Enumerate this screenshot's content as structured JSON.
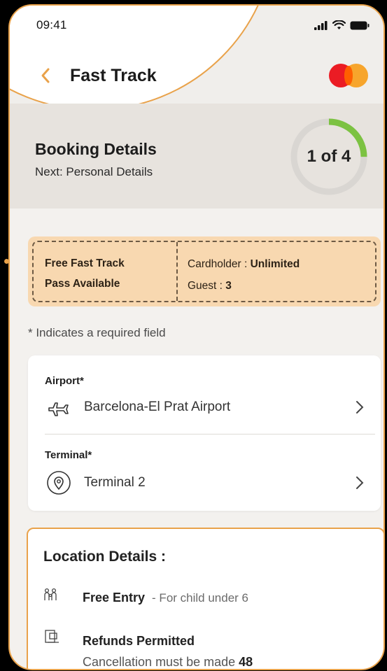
{
  "status_bar": {
    "time": "09:41"
  },
  "header": {
    "title": "Fast Track"
  },
  "booking": {
    "title": "Booking Details",
    "next": "Next: Personal Details",
    "step_label": "1 of 4",
    "step_current": 1,
    "step_total": 4
  },
  "pass": {
    "line1": "Free Fast Track",
    "line2": "Pass Available",
    "cardholder_label": "Cardholder : ",
    "cardholder_value": "Unlimited",
    "guest_label": "Guest : ",
    "guest_value": "3"
  },
  "required_note": "* Indicates a required field",
  "airport": {
    "label": "Airport*",
    "value": "Barcelona-El Prat Airport",
    "icon": "airplane-icon"
  },
  "terminal": {
    "label": "Terminal*",
    "value": "Terminal 2",
    "icon": "location-pin-icon"
  },
  "location_details": {
    "title": "Location Details :",
    "free_entry": "Free Entry",
    "free_entry_sub": "- For child under 6",
    "refunds": "Refunds Permitted",
    "cancellation_prefix": "Cancellation must be made ",
    "cancellation_hours": "48"
  },
  "colors": {
    "accent": "#e9a24a",
    "pass_bg": "#f8d8b0",
    "progress": "#7cc242",
    "progress_track": "#d9d6d2",
    "banner_bg": "#e7e3de"
  }
}
